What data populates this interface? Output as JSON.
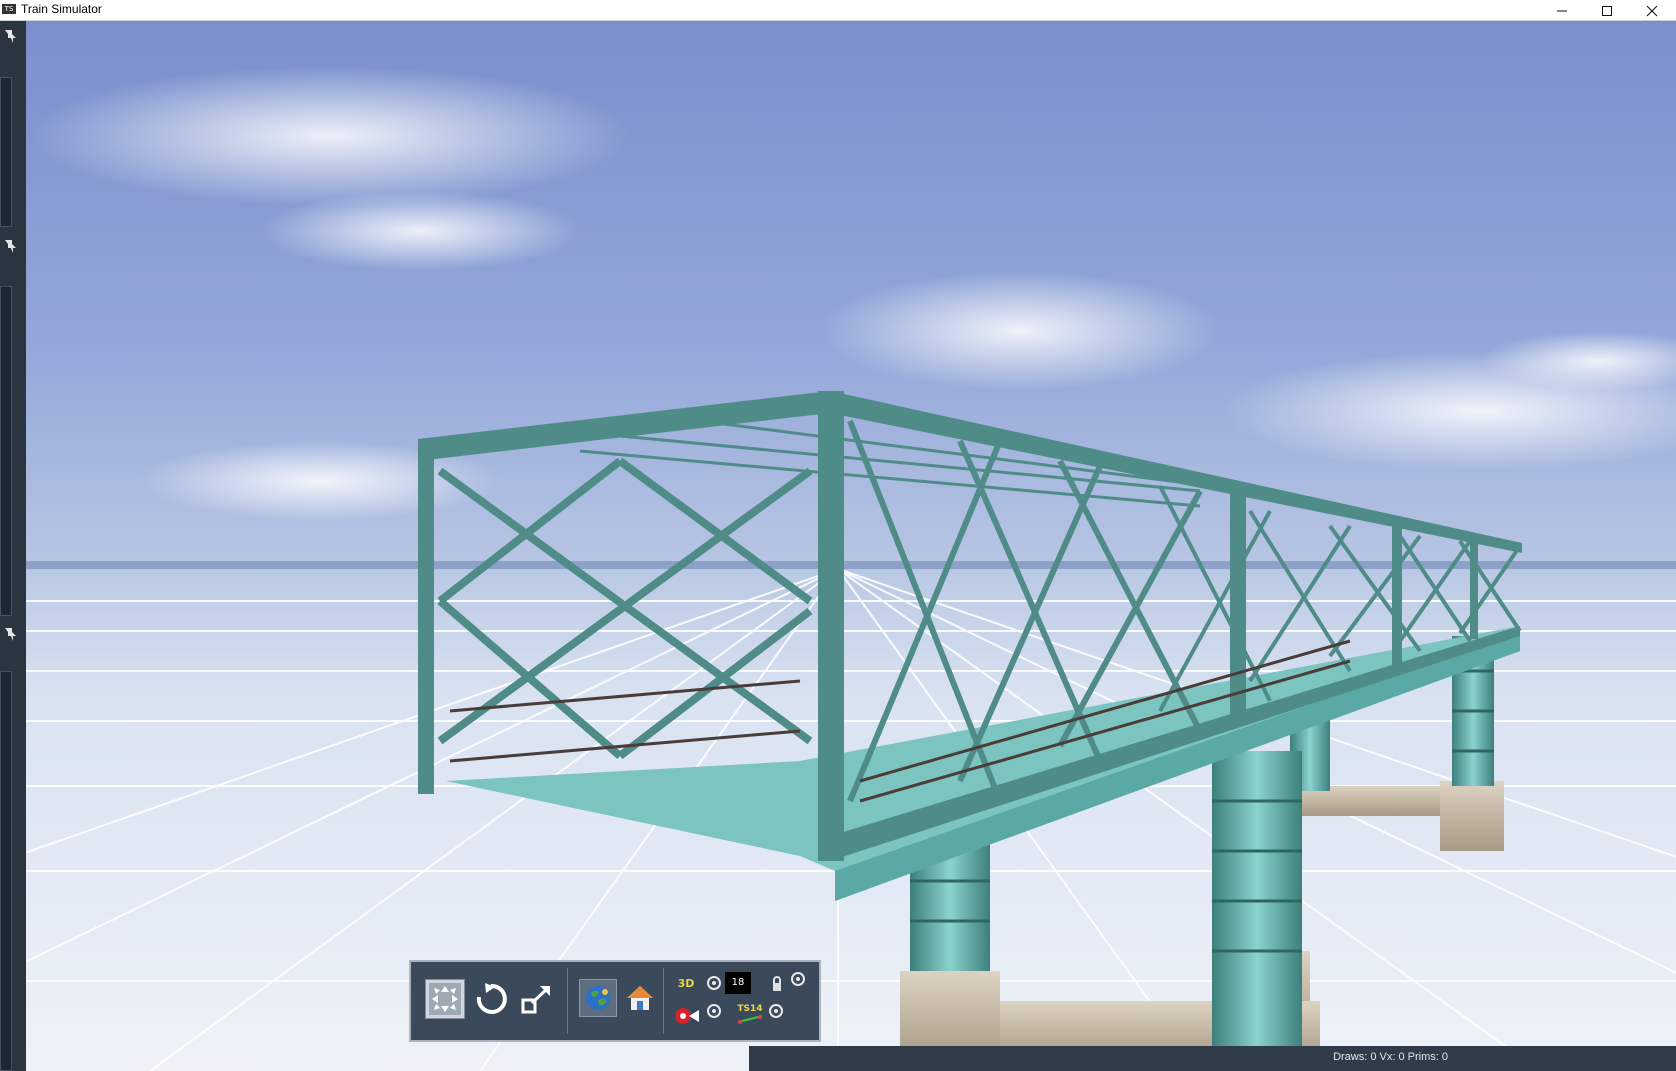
{
  "app": {
    "title": "Train Simulator",
    "icon_label": "TS"
  },
  "window_controls": {
    "minimize": "minimize-icon",
    "maximize": "maximize-icon",
    "close": "close-icon"
  },
  "sidebar": {
    "pins": [
      "pin-icon",
      "pin-icon",
      "pin-icon"
    ]
  },
  "toolbar": {
    "buttons": [
      {
        "name": "move-icon"
      },
      {
        "name": "rotate-icon"
      },
      {
        "name": "scale-icon"
      },
      {
        "name": "world-view-icon"
      },
      {
        "name": "home-icon"
      }
    ],
    "label_3d": "3D",
    "counter_value": "18",
    "label_ts": "TS14"
  },
  "status": {
    "text": "Draws: 0 Vx: 0 Prims: 0"
  },
  "colors": {
    "sky_top": "#7d93cf",
    "sky_horizon": "#b9c7e3",
    "ground": "#e9eef6",
    "grid": "#ffffff",
    "bridge_steel": "#4f8c88",
    "bridge_deck": "#7cc4c0",
    "pier_stone": "#c9bfae",
    "toolbar_bg": "#3b4a5a",
    "statusbar_bg": "#2f3b48"
  }
}
